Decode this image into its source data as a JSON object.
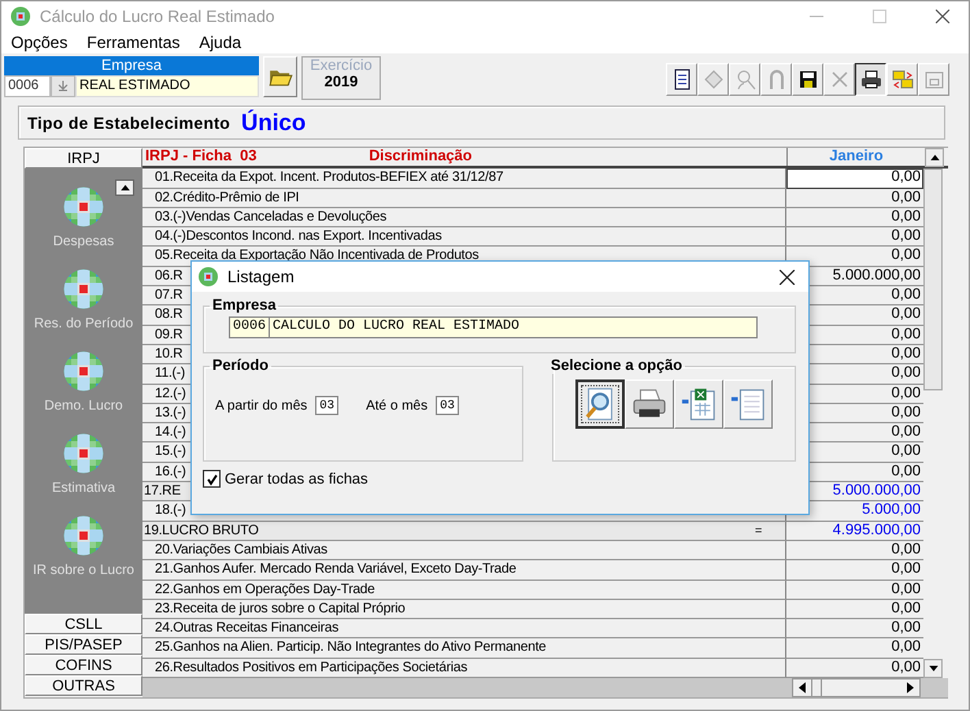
{
  "window": {
    "title": "Cálculo do Lucro Real Estimado"
  },
  "menu": [
    "Opções",
    "Ferramentas",
    "Ajuda"
  ],
  "empresa": {
    "label": "Empresa",
    "code": "0006",
    "name": "REAL ESTIMADO"
  },
  "exercicio": {
    "label": "Exercício",
    "value": "2019"
  },
  "toolbar": [
    {
      "kind": "document",
      "disabled": false,
      "pressed": false
    },
    {
      "kind": "diamond",
      "disabled": true,
      "pressed": false
    },
    {
      "kind": "search-person",
      "disabled": true,
      "pressed": false
    },
    {
      "kind": "magnet",
      "disabled": true,
      "pressed": false
    },
    {
      "kind": "save",
      "disabled": false,
      "pressed": false
    },
    {
      "kind": "delete",
      "disabled": true,
      "pressed": false
    },
    {
      "kind": "print",
      "disabled": false,
      "pressed": true
    },
    {
      "kind": "swap-folders",
      "disabled": false,
      "pressed": false
    },
    {
      "kind": "folder-grid",
      "disabled": true,
      "pressed": false
    }
  ],
  "tipo": {
    "label": "Tipo de Estabelecimento",
    "value": "Único"
  },
  "sidebar": [
    {
      "label": "IRPJ",
      "expanded": true,
      "items": [
        "Despesas",
        "Res. do Período",
        "Demo. Lucro",
        "Estimativa",
        "IR sobre o Lucro"
      ]
    },
    {
      "label": "CSLL",
      "expanded": false
    },
    {
      "label": "PIS/PASEP",
      "expanded": false
    },
    {
      "label": "COFINS",
      "expanded": false
    },
    {
      "label": "OUTRAS",
      "expanded": false
    }
  ],
  "grid": {
    "sheet": "IRPJ - Ficha  03",
    "column": "Discriminação",
    "month": "Janeiro",
    "rows": [
      {
        "label": "01.Receita da Expot. Incent. Produtos-BEFIEX até 31/12/87",
        "value": "0,00",
        "kind": "item",
        "computed": false,
        "selected": true
      },
      {
        "label": "02.Crédito-Prêmio de IPI",
        "value": "0,00",
        "kind": "item",
        "computed": false,
        "selected": false
      },
      {
        "label": "03.(-)Vendas Canceladas e Devoluções",
        "value": "0,00",
        "kind": "item",
        "computed": false,
        "selected": false
      },
      {
        "label": "04.(-)Descontos Incond. nas Export. Incentivadas",
        "value": "0,00",
        "kind": "item",
        "computed": false,
        "selected": false
      },
      {
        "label": "05.Receita da Exportação Não Incentivada de Produtos",
        "value": "0,00",
        "kind": "item",
        "computed": false,
        "selected": false
      },
      {
        "label": "06.R",
        "value": "5.000.000,00",
        "kind": "item",
        "computed": false,
        "selected": false
      },
      {
        "label": "07.R",
        "value": "0,00",
        "kind": "item",
        "computed": false,
        "selected": false
      },
      {
        "label": "08.R",
        "value": "0,00",
        "kind": "item",
        "computed": false,
        "selected": false
      },
      {
        "label": "09.R",
        "value": "0,00",
        "kind": "item",
        "computed": false,
        "selected": false
      },
      {
        "label": "10.R",
        "value": "0,00",
        "kind": "item",
        "computed": false,
        "selected": false
      },
      {
        "label": "11.(-)",
        "value": "0,00",
        "kind": "item",
        "computed": false,
        "selected": false
      },
      {
        "label": "12.(-)",
        "value": "0,00",
        "kind": "item",
        "computed": false,
        "selected": false
      },
      {
        "label": "13.(-)",
        "value": "0,00",
        "kind": "item",
        "computed": false,
        "selected": false
      },
      {
        "label": "14.(-)",
        "value": "0,00",
        "kind": "item",
        "computed": false,
        "selected": false
      },
      {
        "label": "15.(-)",
        "value": "0,00",
        "kind": "item",
        "computed": false,
        "selected": false
      },
      {
        "label": "16.(-)",
        "value": "0,00",
        "kind": "item",
        "computed": false,
        "selected": false
      },
      {
        "label": "17.RE",
        "value": "5.000.000,00",
        "kind": "total",
        "computed": true,
        "selected": false
      },
      {
        "label": "18.(-)",
        "value": "5.000,00",
        "kind": "item",
        "computed": true,
        "selected": false
      },
      {
        "label": "19.LUCRO BRUTO",
        "operator": "=",
        "value": "4.995.000,00",
        "kind": "total",
        "computed": true,
        "selected": false
      },
      {
        "label": "20.Variações Cambiais Ativas",
        "value": "0,00",
        "kind": "item",
        "computed": false,
        "selected": false
      },
      {
        "label": "21.Ganhos Aufer. Mercado Renda Variável, Exceto Day-Trade",
        "value": "0,00",
        "kind": "item",
        "computed": false,
        "selected": false
      },
      {
        "label": "22.Ganhos em Operações Day-Trade",
        "value": "0,00",
        "kind": "item",
        "computed": false,
        "selected": false
      },
      {
        "label": "23.Receita de juros sobre o Capital Próprio",
        "value": "0,00",
        "kind": "item",
        "computed": false,
        "selected": false
      },
      {
        "label": "24.Outras Receitas Financeiras",
        "value": "0,00",
        "kind": "item",
        "computed": false,
        "selected": false
      },
      {
        "label": "25.Ganhos na Alien. Particip. Não Integrantes do Ativo Permanente",
        "value": "0,00",
        "kind": "item",
        "computed": false,
        "selected": false
      },
      {
        "label": "26.Resultados Positivos em Participações Societárias",
        "value": "0,00",
        "kind": "item",
        "computed": false,
        "selected": false
      }
    ]
  },
  "dialog": {
    "title": "Listagem",
    "empresa": {
      "label": "Empresa",
      "code": "0006",
      "name": "CALCULO DO LUCRO REAL ESTIMADO"
    },
    "periodo": {
      "label": "Período",
      "from_label": "A partir do mês",
      "from": "03",
      "to_label": "Até o mês",
      "to": "03"
    },
    "options": {
      "label": "Selecione a opção",
      "buttons": [
        {
          "kind": "preview",
          "selected": true
        },
        {
          "kind": "print",
          "selected": false
        },
        {
          "kind": "excel",
          "selected": false
        },
        {
          "kind": "text",
          "selected": false
        }
      ]
    },
    "checkbox": {
      "label": "Gerar todas as fichas",
      "checked": true
    }
  }
}
